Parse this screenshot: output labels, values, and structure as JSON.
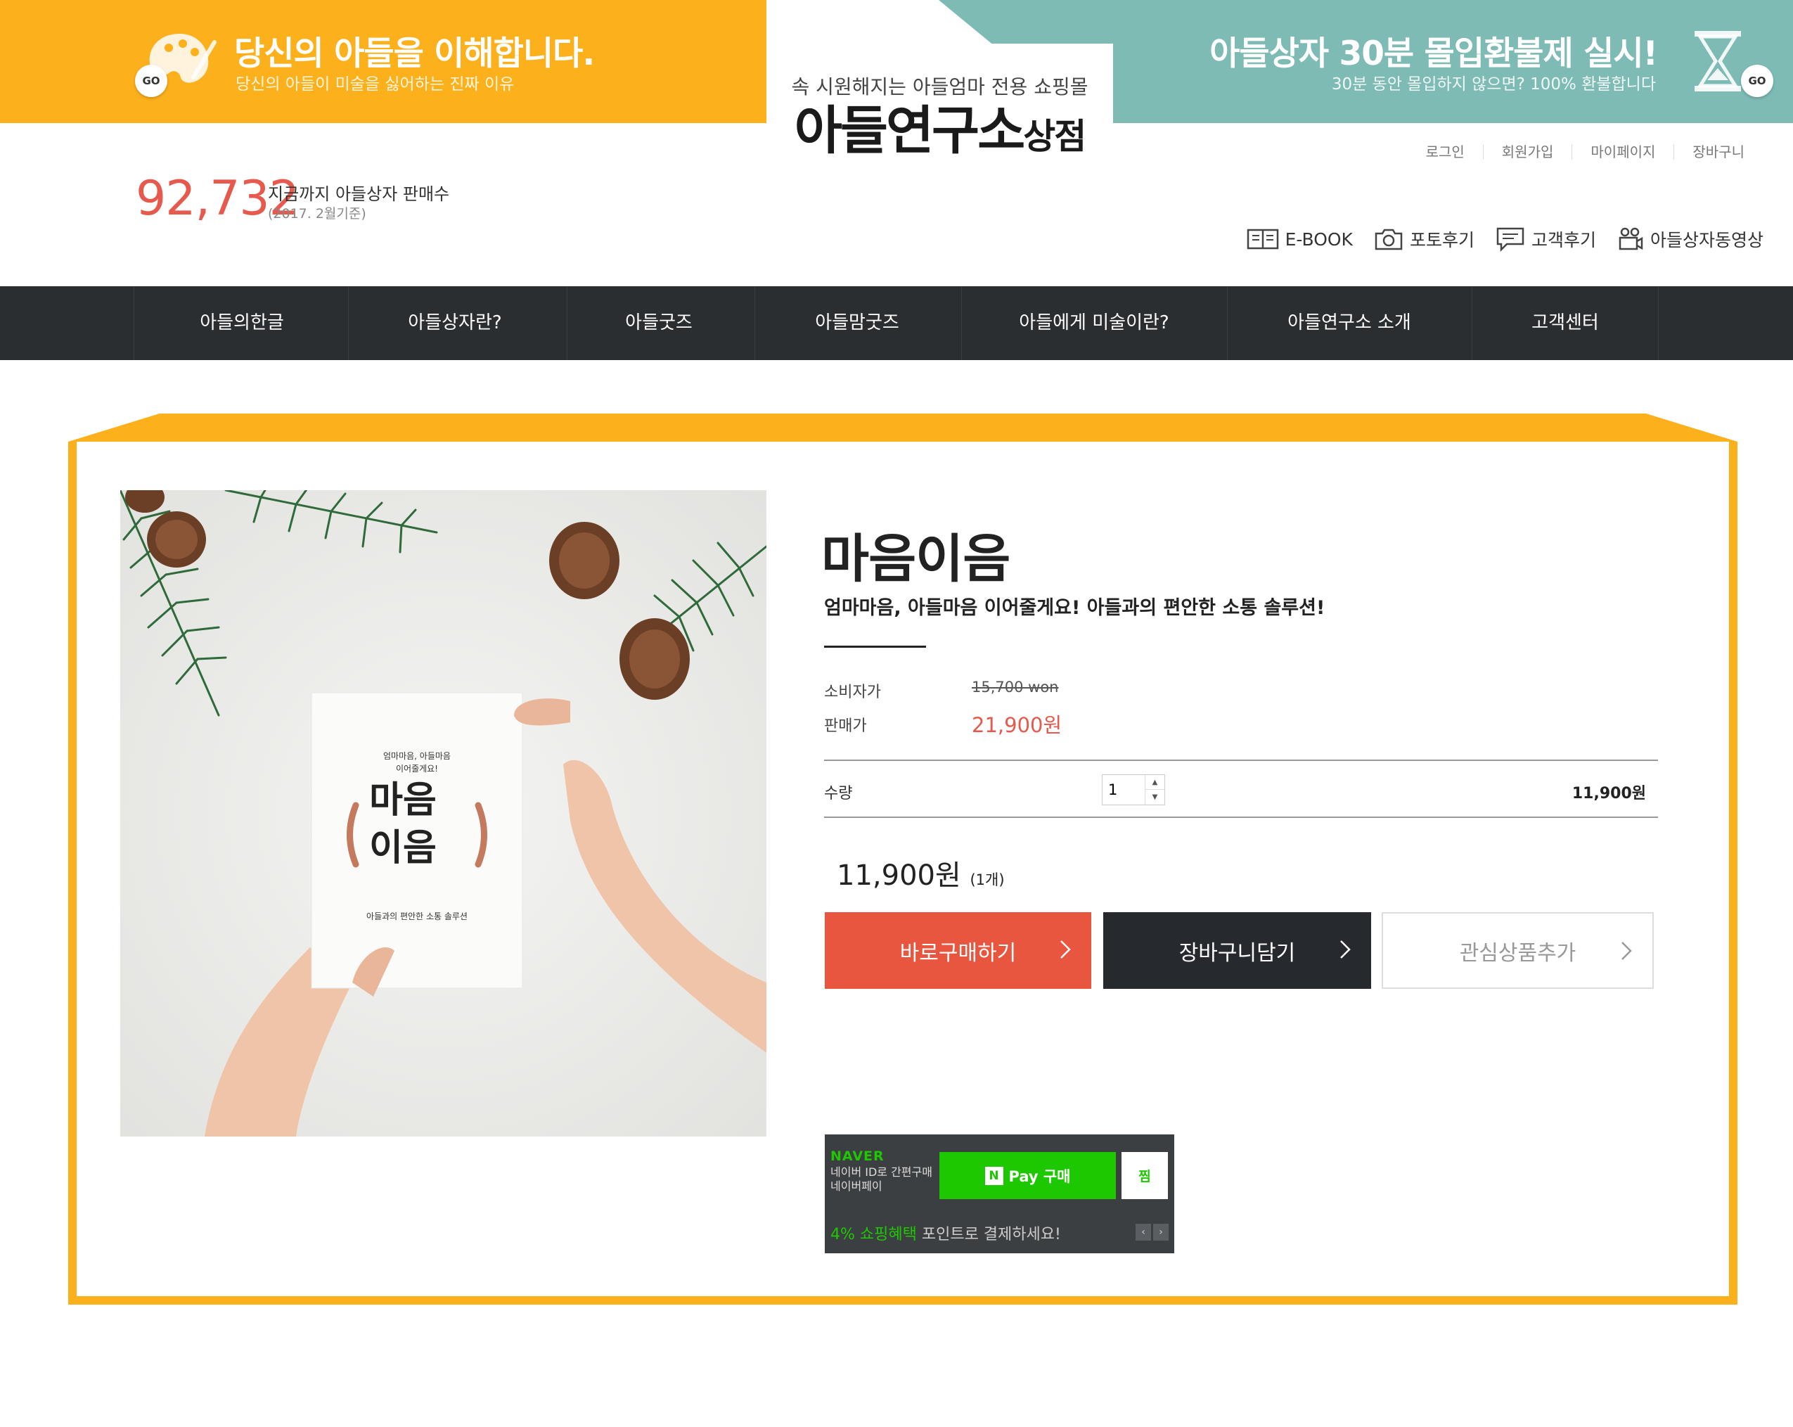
{
  "banner_left": {
    "title": "당신의 아들을 이해합니다.",
    "subtitle": "당신의 아들이 미술을 싫어하는 진짜 이유",
    "go_label": "GO"
  },
  "banner_right": {
    "title": "아들상자 30분 몰입환불제 실시!",
    "subtitle": "30분 동안 몰입하지 않으면? 100% 환불합니다",
    "go_label": "GO"
  },
  "logo": {
    "tagline": "속 시원해지는 아들엄마 전용 쇼핑몰",
    "name": "아들연구소",
    "name_suffix": "상점"
  },
  "util_links": [
    "로그인",
    "회원가입",
    "마이페이지",
    "장바구니"
  ],
  "counter": {
    "number": "92,732",
    "label": "지금까지 아들상자 판매수",
    "date": "(2017. 2월기준)"
  },
  "quick_links": [
    {
      "label": "E-BOOK",
      "icon": "book-icon"
    },
    {
      "label": "포토후기",
      "icon": "camera-icon"
    },
    {
      "label": "고객후기",
      "icon": "chat-icon"
    },
    {
      "label": "아들상자동영상",
      "icon": "video-camera-icon"
    }
  ],
  "nav": {
    "items": [
      "아들의한글",
      "아들상자란?",
      "아들굿즈",
      "아들맘굿즈",
      "아들에게 미술이란?",
      "아들연구소 소개",
      "고객센터"
    ]
  },
  "product": {
    "card": {
      "line1": "엄마마음, 아들마음",
      "line2": "이어줄게요!",
      "title_top": "마음",
      "title_bottom": "이음",
      "footer": "아들과의 편안한 소통 솔루션"
    },
    "title": "마음이음",
    "subtitle": "엄마마음, 아들마음 이어줄게요! 아들과의 편안한 소통 솔루션!",
    "retail_label": "소비자가",
    "retail_price": "15,700 won",
    "sale_label": "판매가",
    "sale_price": "21,900원",
    "qty_label": "수량",
    "qty_value": "1",
    "line_price": "11,900원",
    "total": "11,900원",
    "total_count": "(1개)",
    "buy_label": "바로구매하기",
    "cart_label": "장바구니담기",
    "wish_label": "관심상품추가"
  },
  "naver_pay": {
    "brand": "NAVER",
    "desc_line1": "네이버 ID로 간편구매",
    "desc_line2": "네이버페이",
    "pay_label": "Pay 구매",
    "n_mark": "N",
    "zzim_label": "찜",
    "promo_highlight": "4% 쇼핑혜택",
    "promo_rest": " 포인트로 결제하세요!"
  },
  "colors": {
    "orange": "#fcb11c",
    "teal": "#7fbbb5",
    "accent_red": "#e8563f",
    "nav_dark": "#2b2e31",
    "naver_green": "#1ec800"
  }
}
